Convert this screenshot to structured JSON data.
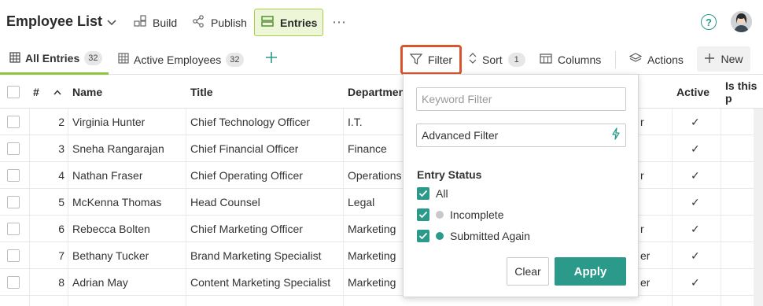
{
  "app": {
    "title": "Employee List"
  },
  "topnav": {
    "build": "Build",
    "publish": "Publish",
    "entries": "Entries",
    "more": "⋯"
  },
  "tabs": {
    "all": {
      "label": "All Entries",
      "count": "32"
    },
    "active": {
      "label": "Active Employees",
      "count": "32"
    }
  },
  "toolbar": {
    "filter": "Filter",
    "sort": "Sort",
    "sort_count": "1",
    "columns": "Columns",
    "actions": "Actions",
    "new": "New"
  },
  "table": {
    "headers": {
      "num": "#",
      "name": "Name",
      "title": "Title",
      "department": "Departmen",
      "active": "Active",
      "extra": "Is this p"
    },
    "rows": [
      {
        "num": "2",
        "name": "Virginia Hunter",
        "title": "Chief Technology Officer",
        "department": "I.T.",
        "trail": "r"
      },
      {
        "num": "3",
        "name": "Sneha Rangarajan",
        "title": "Chief Financial Officer",
        "department": "Finance",
        "trail": ""
      },
      {
        "num": "4",
        "name": "Nathan Fraser",
        "title": "Chief Operating Officer",
        "department": "Operations",
        "trail": "r"
      },
      {
        "num": "5",
        "name": "McKenna Thomas",
        "title": "Head Counsel",
        "department": "Legal",
        "trail": ""
      },
      {
        "num": "6",
        "name": "Rebecca Bolten",
        "title": "Chief Marketing Officer",
        "department": "Marketing",
        "trail": "r"
      },
      {
        "num": "7",
        "name": "Bethany Tucker",
        "title": "Brand Marketing Specialist",
        "department": "Marketing",
        "trail": "er"
      },
      {
        "num": "8",
        "name": "Adrian May",
        "title": "Content Marketing Specialist",
        "department": "Marketing",
        "trail": "er"
      }
    ],
    "active_mark": "✓"
  },
  "filter_popover": {
    "keyword_placeholder": "Keyword Filter",
    "advanced_label": "Advanced Filter",
    "entry_status_title": "Entry Status",
    "options": [
      {
        "label": "All",
        "checked": true
      },
      {
        "label": "Incomplete",
        "checked": true,
        "dot_color": "#c8c8c8"
      },
      {
        "label": "Submitted Again",
        "checked": true,
        "dot_color": "#2b9a8a"
      }
    ],
    "clear_label": "Clear",
    "apply_label": "Apply"
  },
  "colors": {
    "accent": "#2b9a8a",
    "highlight": "#d9542f",
    "tab_underline": "#8cc63f"
  }
}
